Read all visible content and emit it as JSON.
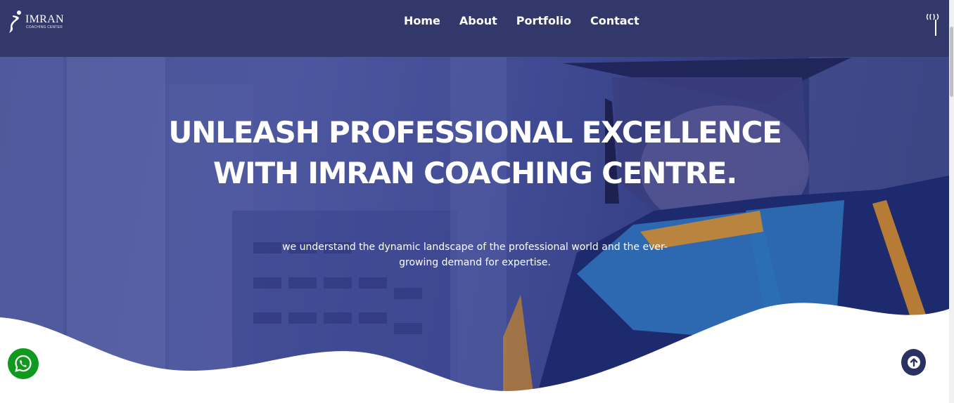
{
  "brand": {
    "name": "IMRAN",
    "tagline": "COACHING CENTER"
  },
  "nav": {
    "items": [
      {
        "label": "Home"
      },
      {
        "label": "About"
      },
      {
        "label": "Portfolio"
      },
      {
        "label": "Contact"
      }
    ]
  },
  "hero": {
    "title": "UNLEASH PROFESSIONAL EXCELLENCE WITH IMRAN COACHING CENTRE.",
    "subtitle": "we understand the dynamic landscape of the professional world and the ever-growing demand for expertise."
  },
  "icons": {
    "menu": "menu-toggle-icon",
    "whatsapp": "whatsapp-icon",
    "back_to_top": "arrow-up-icon"
  },
  "colors": {
    "navbar": "#33386a",
    "hero_overlay": "#3f4a93",
    "whatsapp": "#0f9a1f",
    "back_to_top": "#2c3163",
    "text": "#ffffff"
  }
}
